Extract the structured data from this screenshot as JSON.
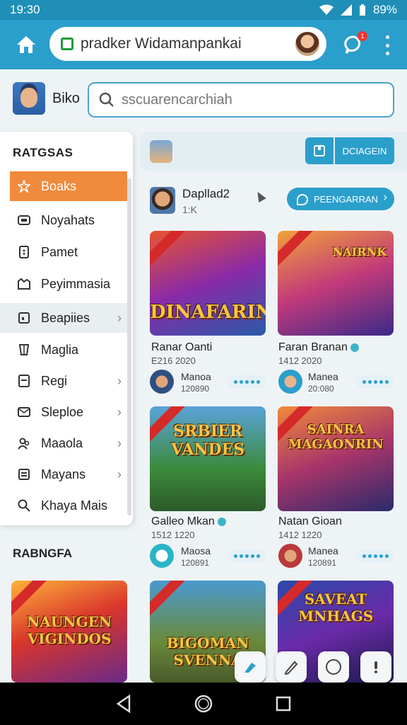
{
  "status": {
    "time": "19:30",
    "battery": "89%"
  },
  "browser": {
    "url": "pradker Widamanpankai",
    "badge": "1"
  },
  "profile": {
    "name": "Biko"
  },
  "search": {
    "placeholder": "sscuarencarchiah"
  },
  "sidebar": {
    "title": "RATGSAS",
    "items": [
      {
        "label": "Boaks",
        "icon": "star-icon",
        "active": true
      },
      {
        "label": "Noyahats",
        "icon": "card-icon"
      },
      {
        "label": "Pamet",
        "icon": "page-icon"
      },
      {
        "label": "Peyimmasia",
        "icon": "folder-icon"
      },
      {
        "label": "Beapiies",
        "icon": "tablet-icon",
        "chevron": true
      },
      {
        "label": "Maglia",
        "icon": "shield-icon"
      },
      {
        "label": "Regi",
        "icon": "note-icon",
        "chevron": true
      },
      {
        "label": "Sleploe",
        "icon": "mail-icon",
        "chevron": true
      },
      {
        "label": "Maaola",
        "icon": "people-icon",
        "chevron": true
      },
      {
        "label": "Mayans",
        "icon": "list-icon",
        "chevron": true
      },
      {
        "label": "Khaya Mais",
        "icon": "search-icon"
      }
    ]
  },
  "bottom": {
    "title": "RABNGFA",
    "card_logo": "NAUNGEN VIGINDOS"
  },
  "panel": {
    "button": "DCIAGEIN"
  },
  "developer": {
    "name": "Dapllad2",
    "count": "1:K",
    "button": "PEENGARRAN"
  },
  "games": [
    {
      "logo": "DINAFARIN",
      "title": "Ranar Oanti",
      "date": "E216 2020",
      "author": "Manoa",
      "num": "120890",
      "verified": false
    },
    {
      "logo": "NAIRNK",
      "title": "Faran Branan",
      "date": "1412 2020",
      "author": "Manea",
      "num": "20:080",
      "verified": true
    },
    {
      "logo": "SRBIER VANDES",
      "title": "Galleo Mkan",
      "date": "1512 1220",
      "author": "Maosa",
      "num": "120891",
      "verified": true
    },
    {
      "logo": "SAINRA MAGAONRIN",
      "title": "Natan Gioan",
      "date": "1412 1220",
      "author": "Manea",
      "num": "120891",
      "verified": false
    },
    {
      "logo": "BIGOMAN SVENNA",
      "title": "",
      "date": "",
      "author": "",
      "num": ""
    },
    {
      "logo": "SAVEAT MNHAGS",
      "title": "",
      "date": "",
      "author": "",
      "num": ""
    }
  ],
  "colors": {
    "accent": "#2b9fcb",
    "active": "#f08a3c"
  }
}
